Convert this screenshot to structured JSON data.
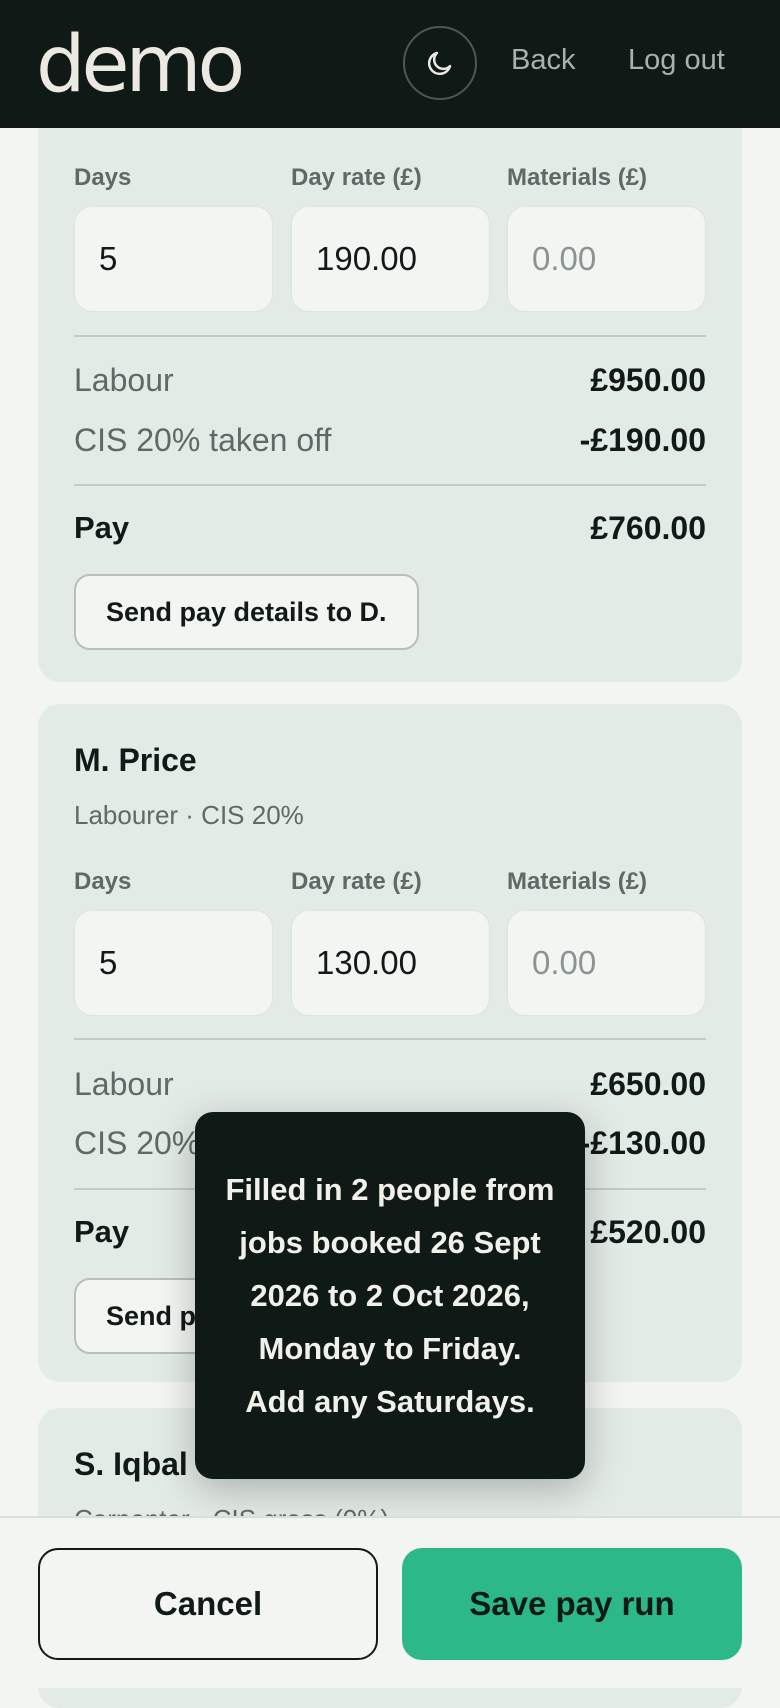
{
  "header": {
    "logo": "demo",
    "theme_icon": "moon-icon",
    "back_label": "Back",
    "logout_label": "Log out"
  },
  "colors": {
    "header_bg": "#0f1a17",
    "card_bg": "#e3ebe6",
    "accent": "#2db88a",
    "muted_text": "#5e6a65"
  },
  "workers": [
    {
      "name": "",
      "role": "",
      "fields": {
        "days_label": "Days",
        "days_value": "5",
        "rate_label": "Day rate (£)",
        "rate_value": "190.00",
        "materials_label": "Materials (£)",
        "materials_placeholder": "0.00"
      },
      "labour_label": "Labour",
      "labour_value": "£950.00",
      "cis_label": "CIS 20% taken off",
      "cis_value": "-£190.00",
      "pay_label": "Pay",
      "pay_value": "£760.00",
      "send_label": "Send pay details to D."
    },
    {
      "name": "M. Price",
      "role": "Labourer · CIS 20%",
      "fields": {
        "days_label": "Days",
        "days_value": "5",
        "rate_label": "Day rate (£)",
        "rate_value": "130.00",
        "materials_label": "Materials (£)",
        "materials_placeholder": "0.00"
      },
      "labour_label": "Labour",
      "labour_value": "£650.00",
      "cis_label": "CIS 20% taken off",
      "cis_value": "-£130.00",
      "pay_label": "Pay",
      "pay_value": "£520.00",
      "send_label": "Send pay details to M."
    },
    {
      "name": "S. Iqbal",
      "role": "Carpenter · CIS gross (0%)"
    }
  ],
  "toast": {
    "message": "Filled in 2 people from jobs booked 26 Sept 2026 to 2 Oct 2026, Monday to Friday. Add any Saturdays."
  },
  "footer": {
    "cancel_label": "Cancel",
    "save_label": "Save pay run"
  }
}
